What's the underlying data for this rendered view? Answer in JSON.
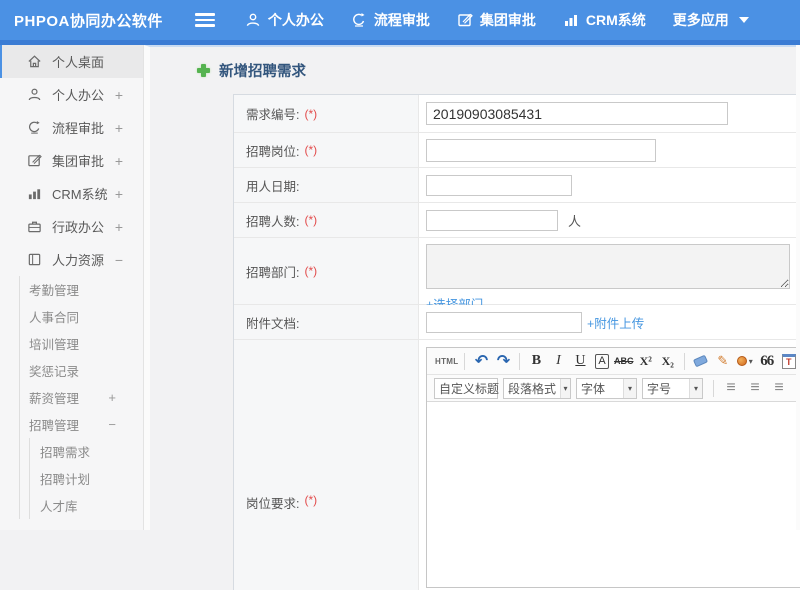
{
  "topbar": {
    "logo": "PHPOA协同办公软件",
    "nav": [
      {
        "label": "个人办公"
      },
      {
        "label": "流程审批"
      },
      {
        "label": "集团审批"
      },
      {
        "label": "CRM系统"
      },
      {
        "label": "更多应用"
      }
    ]
  },
  "sidebar": {
    "items": [
      {
        "label": "个人桌面",
        "expand": ""
      },
      {
        "label": "个人办公",
        "expand": "+"
      },
      {
        "label": "流程审批",
        "expand": "+"
      },
      {
        "label": "集团审批",
        "expand": "+"
      },
      {
        "label": "CRM系统",
        "expand": "+"
      },
      {
        "label": "行政办公",
        "expand": "+"
      },
      {
        "label": "人力资源",
        "expand": "−"
      }
    ],
    "hr_sub": [
      {
        "label": "考勤管理",
        "expand": ""
      },
      {
        "label": "人事合同",
        "expand": ""
      },
      {
        "label": "培训管理",
        "expand": ""
      },
      {
        "label": "奖惩记录",
        "expand": ""
      },
      {
        "label": "薪资管理",
        "expand": "+"
      },
      {
        "label": "招聘管理",
        "expand": "−"
      }
    ],
    "recruit_sub": [
      {
        "label": "招聘需求"
      },
      {
        "label": "招聘计划"
      },
      {
        "label": "人才库"
      }
    ]
  },
  "page": {
    "title": "新增招聘需求"
  },
  "form": {
    "req_no": {
      "label": "需求编号:",
      "required": "(*)",
      "value": "20190903085431"
    },
    "position": {
      "label": "招聘岗位:",
      "required": "(*)"
    },
    "date": {
      "label": "用人日期:"
    },
    "count": {
      "label": "招聘人数:",
      "required": "(*)",
      "suffix": "人"
    },
    "dept": {
      "label": "招聘部门:",
      "required": "(*)",
      "link": "+选择部门"
    },
    "attach": {
      "label": "附件文档:",
      "link": "+附件上传"
    },
    "requirement": {
      "label": "岗位要求:",
      "required": "(*)"
    }
  },
  "editor": {
    "buttons": {
      "html": "HTML",
      "undo": "↶",
      "redo": "↷",
      "bold": "B",
      "italic": "I",
      "underline": "U",
      "autotypeset": "A",
      "strikethrough": "ABC",
      "superscript": "X²",
      "subscript": "X₂",
      "quote": "66",
      "paste_label": "T",
      "fontcolor": "A",
      "backcolor": "a",
      "caret": "▾"
    },
    "dropdowns": [
      {
        "label": "自定义标题"
      },
      {
        "label": "段落格式"
      },
      {
        "label": "字体"
      },
      {
        "label": "字号"
      }
    ],
    "align_glyph": "≡"
  },
  "colors": {
    "topbar": "#4b91e4",
    "topbar_strip": "#3b7cd4",
    "accent": "#4596e0",
    "required": "#e24c4c",
    "title": "#33567d",
    "link": "#4596e0",
    "green_plus": "#55b34f"
  }
}
